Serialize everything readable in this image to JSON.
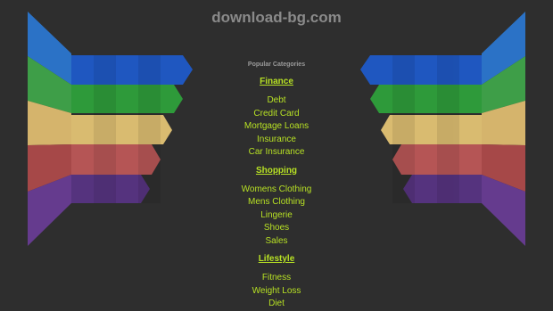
{
  "site": {
    "title": "download-bg.com"
  },
  "popular_label": "Popular Categories",
  "categories": [
    {
      "heading": "Finance",
      "links": [
        "Debt",
        "Credit Card",
        "Mortgage Loans",
        "Insurance",
        "Car Insurance"
      ]
    },
    {
      "heading": "Shopping",
      "links": [
        "Womens Clothing",
        "Mens Clothing",
        "Lingerie",
        "Shoes",
        "Sales"
      ]
    },
    {
      "heading": "Lifestyle",
      "links": [
        "Fitness",
        "Weight Loss",
        "Diet"
      ]
    }
  ],
  "colors": {
    "background": "#2e2e2e",
    "link": "#b8e224",
    "title": "#8a8a8a",
    "stripes": [
      "#2a6fc9",
      "#3d9a44",
      "#d6b56a",
      "#b24a4a",
      "#6a3a92"
    ]
  }
}
